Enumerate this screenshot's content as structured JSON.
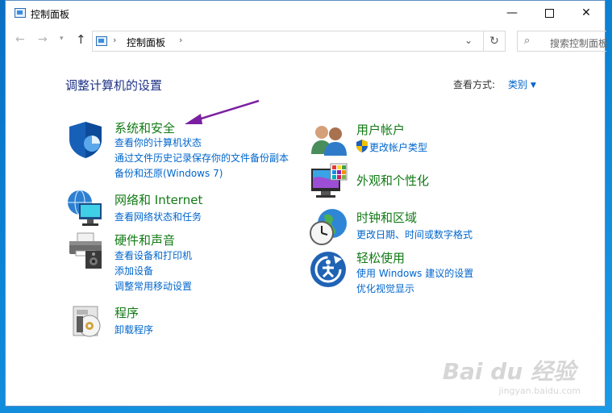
{
  "window": {
    "title": "控制面板",
    "controls": {
      "minimize": "—",
      "close": "✕"
    }
  },
  "address": {
    "back": "←",
    "forward": "→",
    "dropdown": "▾",
    "up": "↑",
    "separator": "›",
    "path": "控制面板",
    "drop": "⌄",
    "refresh": "↻",
    "search_icon": "⌕",
    "search_placeholder": "搜索控制面板"
  },
  "main": {
    "heading": "调整计算机的设置",
    "view_by_label": "查看方式:",
    "view_by_value": "类别",
    "view_by_caret": "▼"
  },
  "categories": [
    {
      "title": "系统和安全",
      "icon": "shield-icon",
      "links": [
        "查看你的计算机状态",
        "通过文件历史记录保存你的文件备份副本",
        "备份和还原(Windows 7)"
      ]
    },
    {
      "title": "网络和 Internet",
      "icon": "network-globe-icon",
      "links": [
        "查看网络状态和任务"
      ]
    },
    {
      "title": "硬件和声音",
      "icon": "printer-speaker-icon",
      "links": [
        "查看设备和打印机",
        "添加设备",
        "调整常用移动设置"
      ]
    },
    {
      "title": "程序",
      "icon": "programs-disc-icon",
      "links": [
        "卸载程序"
      ]
    },
    {
      "title": "用户帐户",
      "icon": "users-icon",
      "links": [
        "更改帐户类型"
      ],
      "link_icon": "uac-shield-icon"
    },
    {
      "title": "外观和个性化",
      "icon": "monitor-palette-icon",
      "links": []
    },
    {
      "title": "时钟和区域",
      "icon": "clock-globe-icon",
      "links": [
        "更改日期、时间或数字格式"
      ]
    },
    {
      "title": "轻松使用",
      "icon": "ease-of-access-icon",
      "links": [
        "使用 Windows 建议的设置",
        "优化视觉显示"
      ]
    }
  ],
  "annotation": {
    "arrow_color": "#7b1fa2"
  },
  "watermark": {
    "text": "Bai du 经验",
    "sub": "jingyan.baidu.com"
  },
  "colors": {
    "category_title": "#117a14",
    "link": "#0066cc",
    "heading": "#1e3287",
    "desktop": "#0b85d6"
  }
}
